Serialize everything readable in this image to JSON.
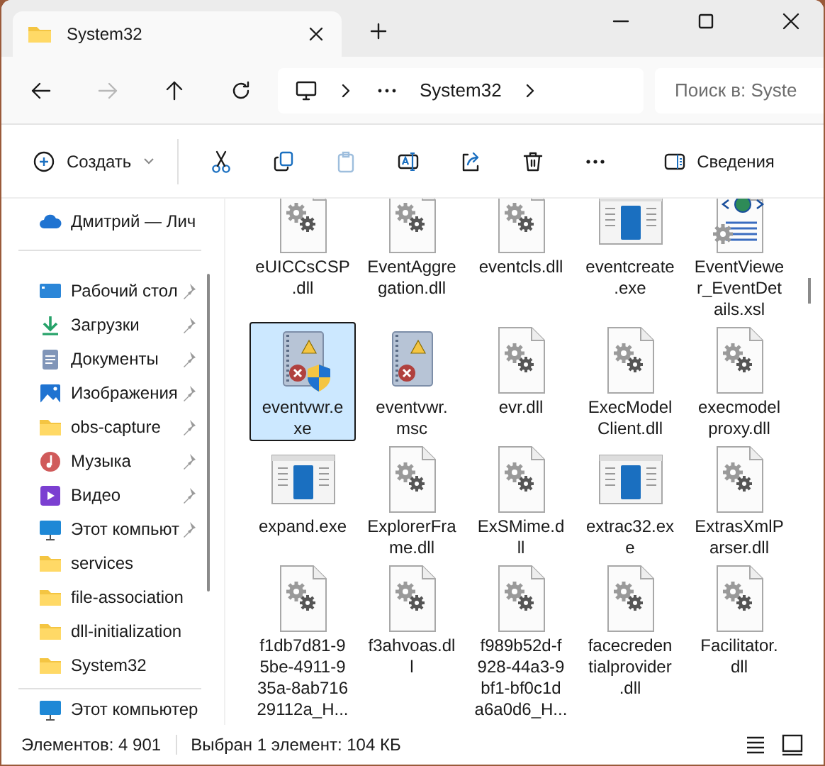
{
  "window": {
    "tab_title": "System32"
  },
  "nav": {
    "back_disabled": false,
    "forward_disabled": true,
    "breadcrumb": "System32",
    "search": {
      "placeholder": "Поиск в: Syste"
    }
  },
  "toolbar": [
    {
      "kind": "create",
      "label": "Создать",
      "disabled": false
    },
    {
      "kind": "cut",
      "disabled": false
    },
    {
      "kind": "copy",
      "disabled": false
    },
    {
      "kind": "paste",
      "disabled": true
    },
    {
      "kind": "rename",
      "disabled": false
    },
    {
      "kind": "share",
      "disabled": false
    },
    {
      "kind": "delete",
      "disabled": false
    },
    {
      "kind": "more",
      "disabled": false
    },
    {
      "kind": "details",
      "label": "Сведения",
      "disabled": false
    }
  ],
  "sidebar": {
    "top": {
      "kind": "cloud",
      "label": "Дмитрий — Лич"
    },
    "items": [
      {
        "kind": "desktop",
        "label": "Рабочий стол",
        "pinned": true
      },
      {
        "kind": "downloads",
        "label": "Загрузки",
        "pinned": true
      },
      {
        "kind": "documents",
        "label": "Документы",
        "pinned": true
      },
      {
        "kind": "pictures",
        "label": "Изображения",
        "pinned": true
      },
      {
        "kind": "folder",
        "label": "obs-capture",
        "pinned": true
      },
      {
        "kind": "music",
        "label": "Музыка",
        "pinned": true
      },
      {
        "kind": "video",
        "label": "Видео",
        "pinned": true
      },
      {
        "kind": "computer",
        "label": "Этот компьют",
        "pinned": true
      },
      {
        "kind": "folder",
        "label": "services",
        "pinned": false
      },
      {
        "kind": "folder",
        "label": "file-association",
        "pinned": false
      },
      {
        "kind": "folder",
        "label": "dll-initialization",
        "pinned": false
      },
      {
        "kind": "folder",
        "label": "System32",
        "pinned": false
      }
    ],
    "bottom": {
      "kind": "computer",
      "label": "Этот компьютер"
    }
  },
  "files": [
    {
      "kind": "dll",
      "label_lines": [
        "eUICCsCSP",
        ".dll"
      ],
      "selected": false
    },
    {
      "kind": "dll",
      "label_lines": [
        "EventAggre",
        "gation.dll"
      ],
      "selected": false
    },
    {
      "kind": "dll",
      "label_lines": [
        "eventcls.dll"
      ],
      "selected": false
    },
    {
      "kind": "exe",
      "label_lines": [
        "eventcreate",
        ".exe"
      ],
      "selected": false
    },
    {
      "kind": "xsl",
      "label_lines": [
        "EventViewe",
        "r_EventDet",
        "ails.xsl"
      ],
      "selected": false
    },
    {
      "kind": "eventlog-shield",
      "label_lines": [
        "eventvwr.e",
        "xe"
      ],
      "selected": true
    },
    {
      "kind": "eventlog",
      "label_lines": [
        "eventvwr.",
        "msc"
      ],
      "selected": false
    },
    {
      "kind": "dll",
      "label_lines": [
        "evr.dll"
      ],
      "selected": false
    },
    {
      "kind": "dll",
      "label_lines": [
        "ExecModel",
        "Client.dll"
      ],
      "selected": false
    },
    {
      "kind": "dll",
      "label_lines": [
        "execmodel",
        "proxy.dll"
      ],
      "selected": false
    },
    {
      "kind": "exe",
      "label_lines": [
        "expand.exe"
      ],
      "selected": false
    },
    {
      "kind": "dll",
      "label_lines": [
        "ExplorerFra",
        "me.dll"
      ],
      "selected": false
    },
    {
      "kind": "dll",
      "label_lines": [
        "ExSMime.d",
        "ll"
      ],
      "selected": false
    },
    {
      "kind": "exe",
      "label_lines": [
        "extrac32.ex",
        "e"
      ],
      "selected": false
    },
    {
      "kind": "dll",
      "label_lines": [
        "ExtrasXmlP",
        "arser.dll"
      ],
      "selected": false
    },
    {
      "kind": "dll",
      "label_lines": [
        "f1db7d81-9",
        "5be-4911-9",
        "35a-8ab716",
        "29112a_H..."
      ],
      "selected": false
    },
    {
      "kind": "dll",
      "label_lines": [
        "f3ahvoas.dl",
        "l"
      ],
      "selected": false
    },
    {
      "kind": "dll",
      "label_lines": [
        "f989b52d-f",
        "928-44a3-9",
        "bf1-bf0c1d",
        "a6a0d6_H..."
      ],
      "selected": false
    },
    {
      "kind": "dll",
      "label_lines": [
        "facecreden",
        "tialprovider",
        ".dll"
      ],
      "selected": false
    },
    {
      "kind": "dll",
      "label_lines": [
        "Facilitator.",
        "dll"
      ],
      "selected": false
    }
  ],
  "status_bar": {
    "count": "Элементов: 4 901",
    "selection": "Выбран 1 элемент: 104 КБ"
  }
}
